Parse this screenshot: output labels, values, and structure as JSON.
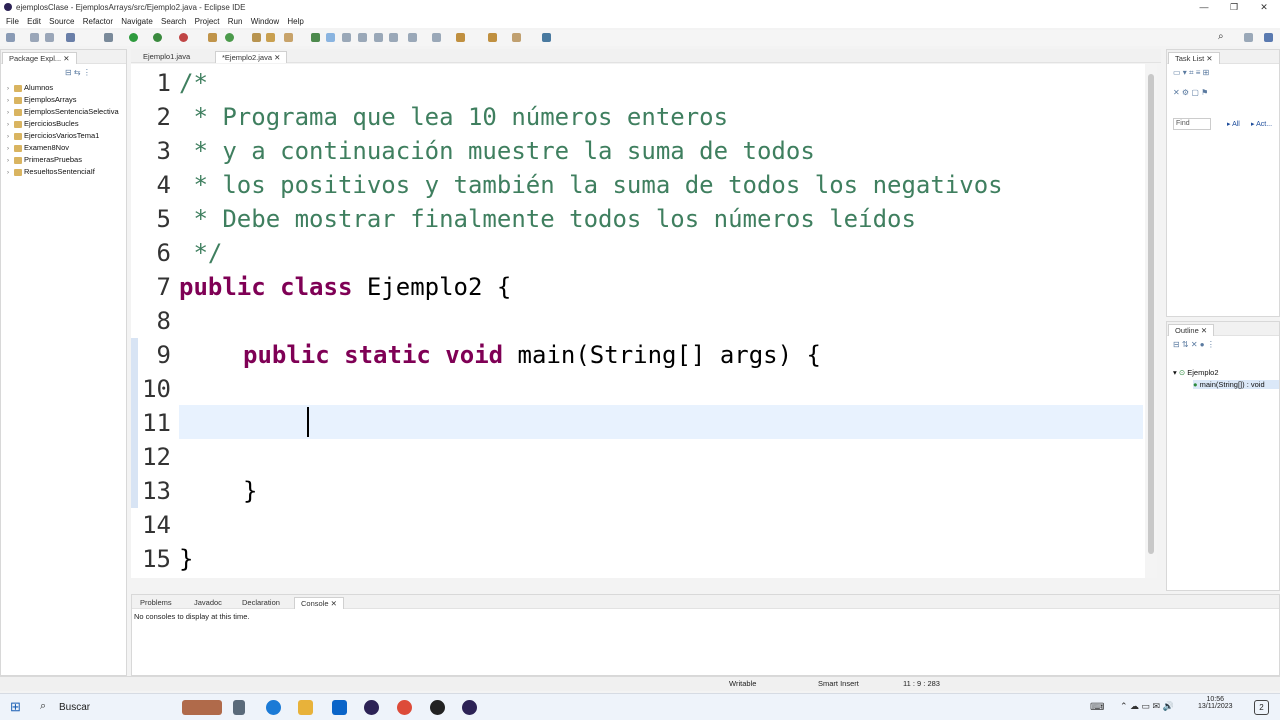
{
  "window": {
    "title": "ejemplosClase - EjemplosArrays/src/Ejemplo2.java - Eclipse IDE"
  },
  "menu": [
    "File",
    "Edit",
    "Source",
    "Refactor",
    "Navigate",
    "Search",
    "Project",
    "Run",
    "Window",
    "Help"
  ],
  "package_explorer": {
    "title": "Package Expl...",
    "projects": [
      "Alumnos",
      "EjemplosArrays",
      "EjemplosSentenciaSelectiva",
      "EjerciciosBucles",
      "EjerciciosVariosTema1",
      "Examen8Nov",
      "PrimerasPruebas",
      "ResueltosSentenciaIf"
    ]
  },
  "editor": {
    "tabs": [
      "Ejemplo1.java",
      "*Ejemplo2.java"
    ],
    "line_numbers": [
      "1",
      "2",
      "3",
      "4",
      "5",
      "6",
      "7",
      "8",
      "9",
      "10",
      "11",
      "12",
      "13",
      "14",
      "15"
    ],
    "lines": {
      "l1": "/*",
      "l2": " * Programa que lea 10 números enteros",
      "l3": " * y a continuación muestre la suma de todos",
      "l4": " * los positivos y también la suma de todos los negativos",
      "l5": " * Debe mostrar finalmente todos los números leídos",
      "l6": " */",
      "l7_kw": "public class",
      "l7_rest": " Ejemplo2 {",
      "l9_kw": "public static void",
      "l9_rest": " main(String[] args) {",
      "l13": "}",
      "l15": "}"
    }
  },
  "task_list": {
    "title": "Task List",
    "find_placeholder": "Find",
    "all_label": "All",
    "act_label": "Act..."
  },
  "outline": {
    "title": "Outline",
    "class_name": "Ejemplo2",
    "method": "main(String[]) : void"
  },
  "bottom_panel": {
    "tabs": [
      "Problems",
      "Javadoc",
      "Declaration",
      "Console"
    ],
    "message": "No consoles to display at this time."
  },
  "status": {
    "writable": "Writable",
    "insert_mode": "Smart Insert",
    "position": "11 : 9 : 283"
  },
  "taskbar": {
    "search_label": "Buscar",
    "time": "10:56",
    "date": "13/11/2023",
    "notification_count": "2"
  },
  "colors": {
    "keyword": "#7f0055",
    "comment": "#3f7f5f",
    "current_line": "#e8f2fe"
  }
}
